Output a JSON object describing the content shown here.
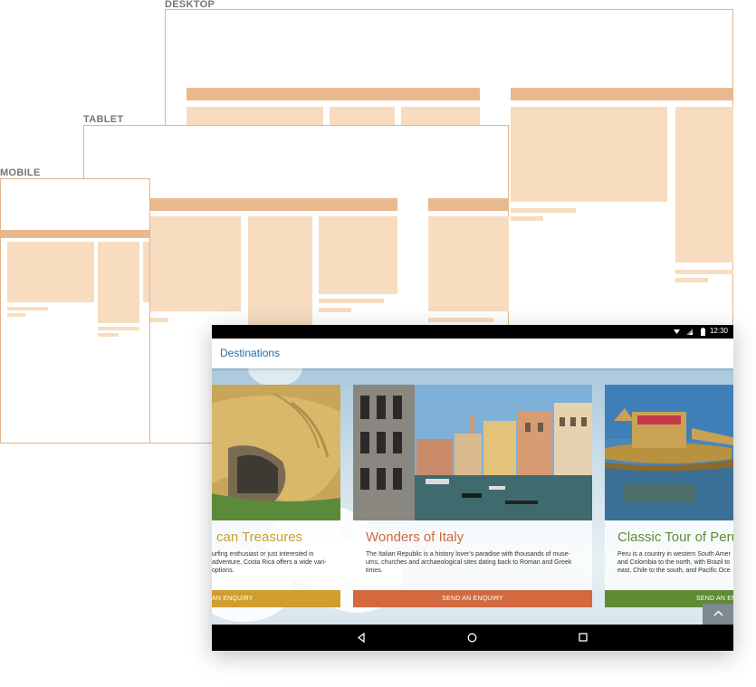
{
  "labels": {
    "desktop": "DESKTOP",
    "tablet": "TABLET",
    "mobile": "MOBILE"
  },
  "device": {
    "status_time": "12:30",
    "app_title": "Destinations",
    "cards": [
      {
        "title": "Costa Rican Treasures",
        "title_visible": "can Treasures",
        "desc_visible": "urfing enthusiast or just interested in\nadventure, Costa Rica offers a wide vari-\noptions.",
        "button_visible": "AN ENQUIRY",
        "accent": "#cf9e2c"
      },
      {
        "title": "Wonders of Italy",
        "description": "The Italian Republic is a history lover's paradise with thousands of muse-ums, churches and archaeological sites dating back to Roman and Greek times.",
        "button": "SEND AN ENQUIRY",
        "accent": "#d2693f"
      },
      {
        "title": "Classic Tour of Peru",
        "title_visible": "Classic Tour of Peru",
        "desc_visible": "Peru is a country in western South Amer\nand Colombia to the north, with Brazil to\neast, Chile to the south, and Pacific Oce",
        "button_visible": "SEND AN EN",
        "accent": "#5f8b35"
      }
    ]
  },
  "colors": {
    "wireframe_bar": "#e8b98e",
    "wireframe_box": "#f7dcc0",
    "link_blue": "#1f6fa8"
  }
}
